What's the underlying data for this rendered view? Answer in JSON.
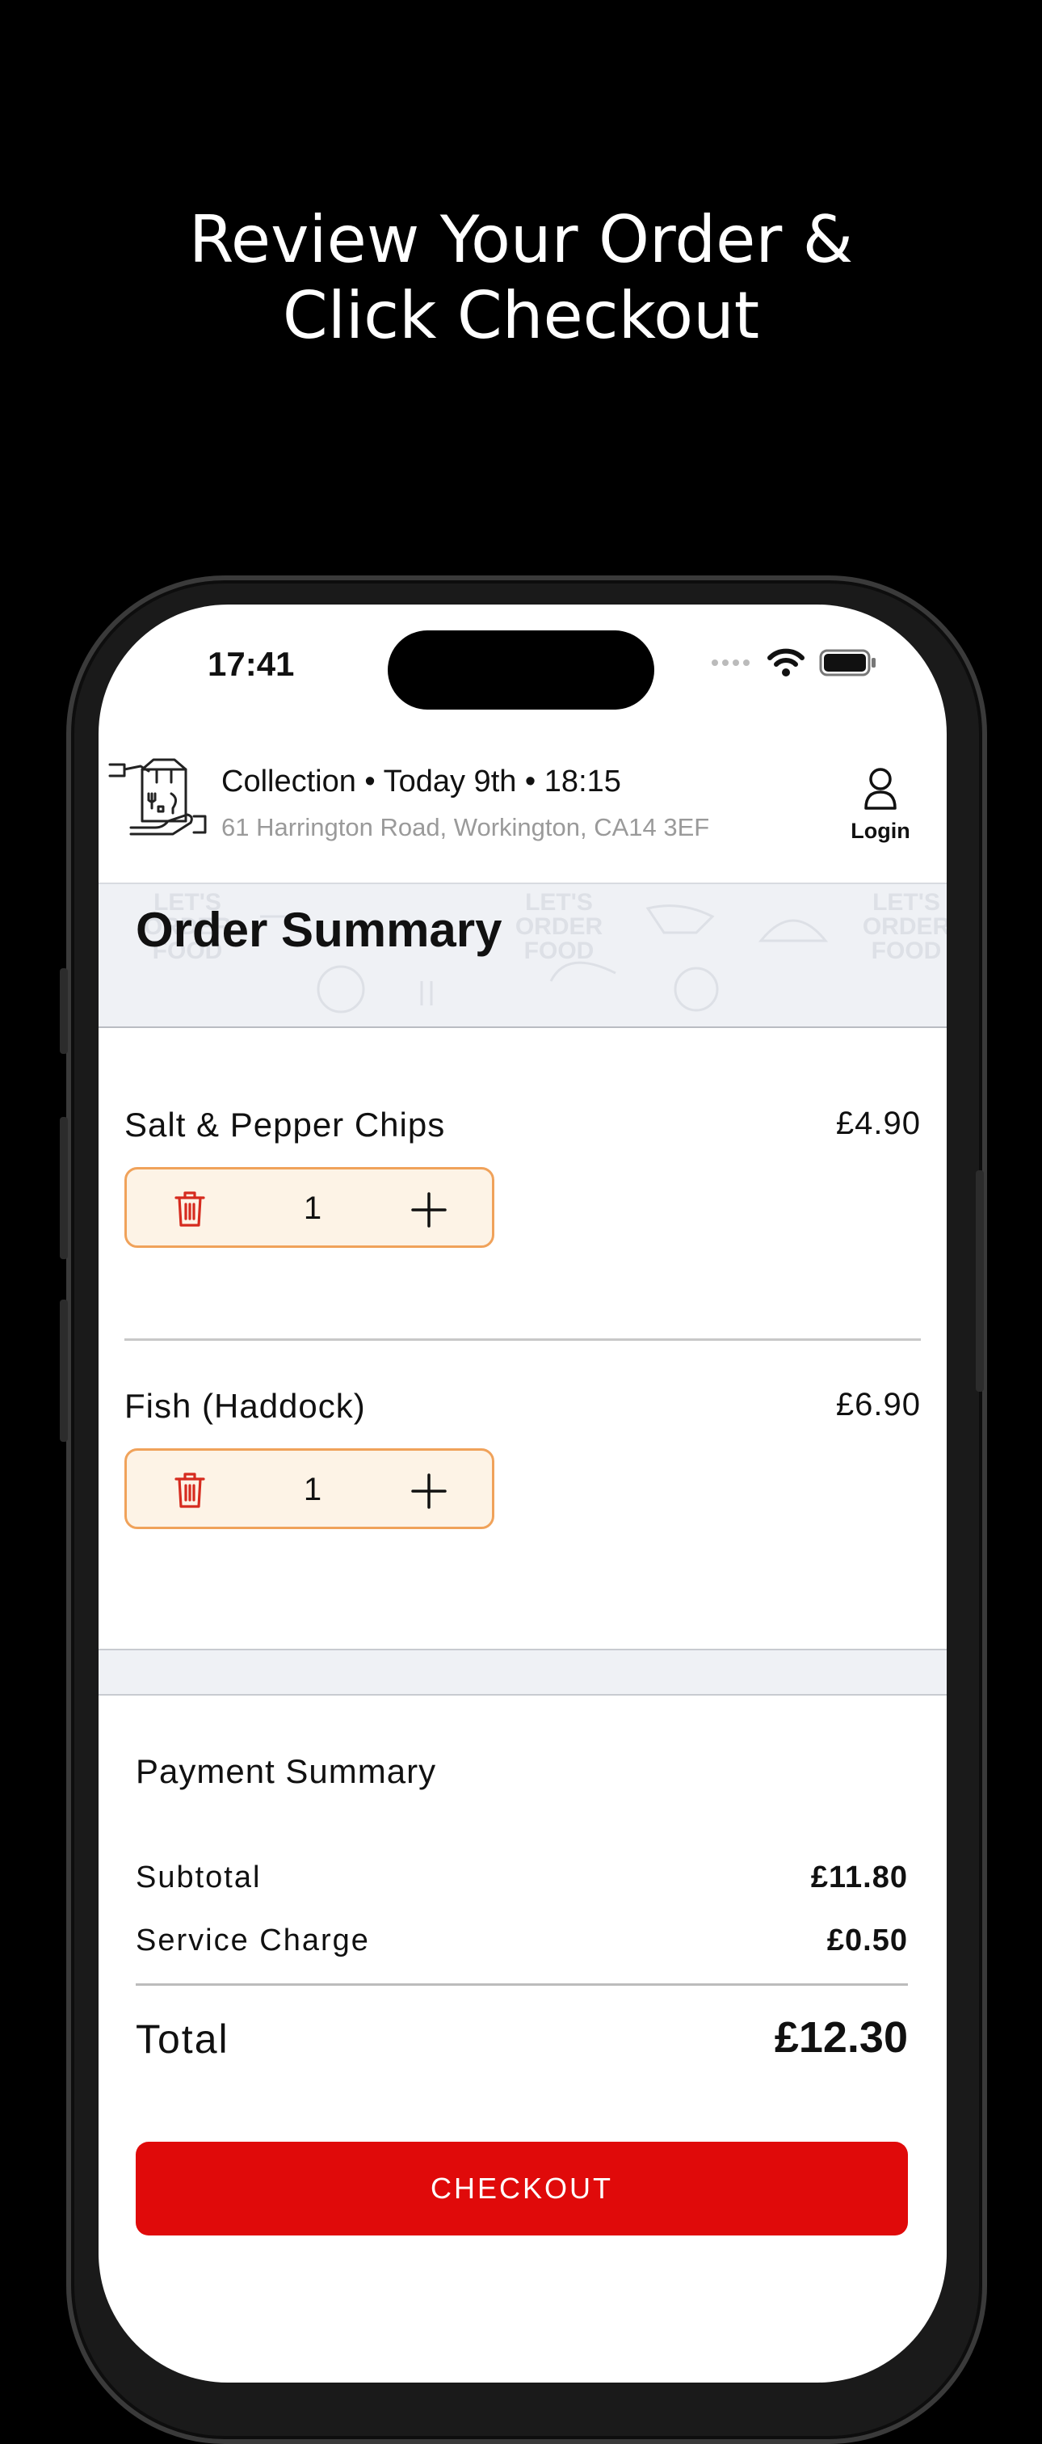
{
  "headline": {
    "line1": "Review Your Order &",
    "line2": "Click Checkout"
  },
  "status_bar": {
    "time": "17:41"
  },
  "header": {
    "order_info": "Collection • Today 9th • 18:15",
    "address": "61 Harrington Road, Workington, CA14  3EF",
    "login_label": "Login"
  },
  "banner": {
    "title": "Order Summary",
    "pattern_text": "LET'S ORDER FOOD"
  },
  "items": [
    {
      "name": "Salt & Pepper Chips",
      "price": "£4.90",
      "quantity": "1"
    },
    {
      "name": "Fish (Haddock)",
      "price": "£6.90",
      "quantity": "1"
    }
  ],
  "payment": {
    "title": "Payment Summary",
    "subtotal_label": "Subtotal",
    "subtotal_value": "£11.80",
    "service_label": "Service Charge",
    "service_value": "£0.50",
    "total_label": "Total",
    "total_value": "£12.30"
  },
  "checkout_label": "CHECKOUT",
  "colors": {
    "accent": "#e00a0a",
    "stepper_bg": "#fdf3e6",
    "stepper_border": "#f0a25a"
  }
}
